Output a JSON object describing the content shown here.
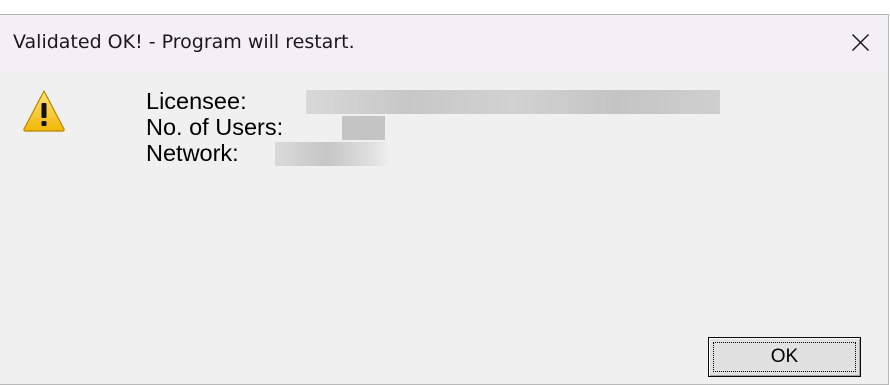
{
  "window": {
    "title": "Validated OK! - Program will restart.",
    "close_icon": "close-icon"
  },
  "message": {
    "icon": "warning-icon",
    "licensee_label": "Licensee:",
    "users_label": "No. of Users:",
    "network_label": "Network:"
  },
  "buttons": {
    "ok_label": "OK"
  },
  "colors": {
    "titlebar": "#f3eff6",
    "client": "#f0f0f0",
    "warning_fill": "#f5c518",
    "button_face": "#e1e1e1"
  }
}
